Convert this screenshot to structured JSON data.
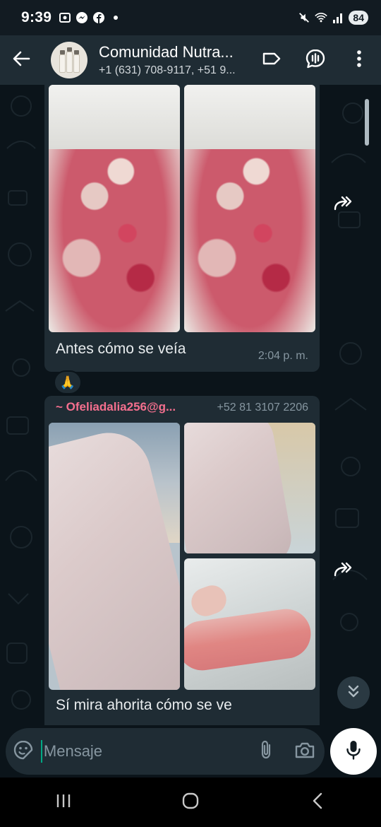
{
  "status_bar": {
    "time": "9:39",
    "battery": "84"
  },
  "header": {
    "title": "Comunidad Nutra...",
    "subtitle": "+1 (631) 708-9117, +51 9..."
  },
  "messages": [
    {
      "caption": "Antes cómo se veía",
      "time": "2:04 p. m.",
      "reaction": "🙏"
    },
    {
      "sender": "~ Ofeliadalia256@g...",
      "sender_phone": "+52 81 3107 2206",
      "caption": "Sí mira ahorita cómo se ve"
    }
  ],
  "composer": {
    "placeholder": "Mensaje"
  },
  "colors": {
    "header_bg": "#1f2c34",
    "chat_bg": "#0b141a",
    "bubble_bg": "#1f2c34",
    "sender_name": "#f46f8e",
    "accent": "#00a884"
  },
  "icons": {
    "back": "arrow-left-icon",
    "label": "label-tag-icon",
    "voice_chat": "voice-chat-icon",
    "more": "more-vert-icon",
    "forward": "forward-icon",
    "scroll_down": "double-chevron-down-icon",
    "sticker": "sticker-icon",
    "attach": "paperclip-icon",
    "camera": "camera-icon",
    "mic": "mic-icon"
  }
}
